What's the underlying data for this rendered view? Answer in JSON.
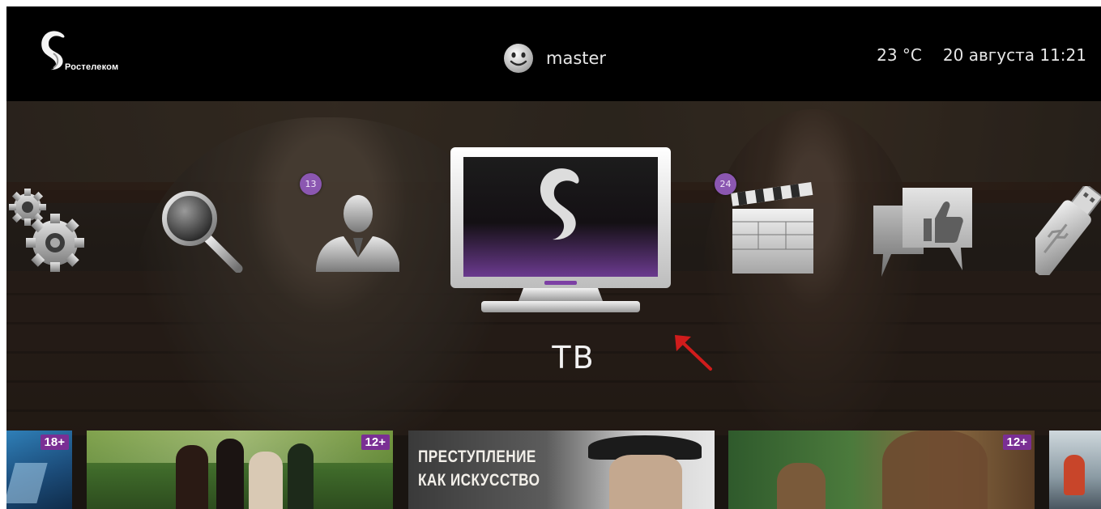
{
  "topbar": {
    "logo_text": "Ростелеком",
    "user_icon": "smiley-icon",
    "username": "master",
    "temperature": "23 °C",
    "date": "20 августа",
    "time": "11:21"
  },
  "menu": {
    "selected_label": "ТВ",
    "items": [
      {
        "name": "settings",
        "icon": "gears-icon"
      },
      {
        "name": "search",
        "icon": "magnifier-icon"
      },
      {
        "name": "profile",
        "icon": "user-icon",
        "badge": "13"
      },
      {
        "name": "tv",
        "icon": "tv-icon",
        "selected": true
      },
      {
        "name": "video",
        "icon": "clapperboard-icon",
        "badge": "24"
      },
      {
        "name": "social",
        "icon": "like-bubble-icon"
      },
      {
        "name": "usb",
        "icon": "usb-icon"
      }
    ]
  },
  "posters": [
    {
      "age": "18+"
    },
    {
      "age": "12+"
    },
    {
      "title_line1": "ПРЕСТУПЛЕНИЕ",
      "title_line2": "КАК ИСКУССТВО"
    },
    {
      "age": "12+"
    },
    {}
  ],
  "colors": {
    "accent_purple": "#8b57b1",
    "age_badge": "#7a2f94",
    "annotation_arrow": "#d01c1c"
  }
}
